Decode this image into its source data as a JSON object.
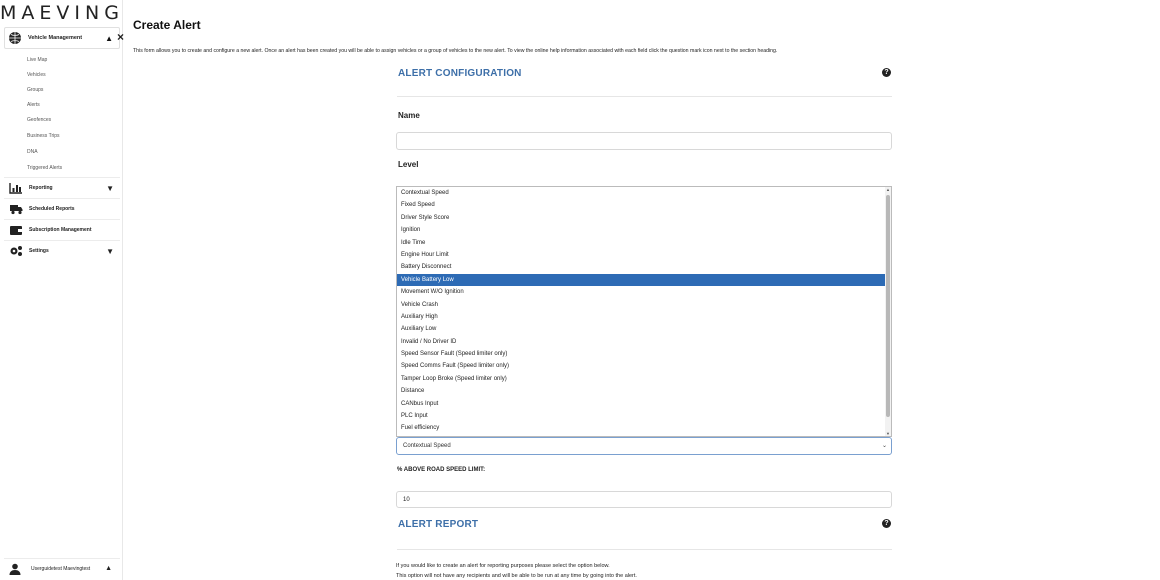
{
  "brand": "MAEVING",
  "sidebar": {
    "vehicle_management": "Vehicle Management",
    "sub_items": [
      "Live Map",
      "Vehicles",
      "Groups",
      "Alerts",
      "Geofences",
      "Business Trips",
      "DNA",
      "Triggered Alerts"
    ],
    "reporting": "Reporting",
    "scheduled_reports": "Scheduled Reports",
    "subscription_management": "Subscription Management",
    "settings": "Settings",
    "user": "Userguidetest Maevingtest"
  },
  "close_glyph": "×",
  "page": {
    "title": "Create Alert",
    "description": "This form allows you to create and configure a new alert. Once an alert has been created you will be able to assign vehicles or a group of vehicles to the new alert. To view the online help information associated with each field click the question mark icon next to the section heading."
  },
  "config": {
    "heading": "ALERT CONFIGURATION",
    "name_label": "Name",
    "name_value": "",
    "level_label": "Level",
    "options": [
      "Contextual Speed",
      "Fixed Speed",
      "Driver Style Score",
      "Ignition",
      "Idle Time",
      "Engine Hour Limit",
      "Battery Disconnect",
      "Vehicle Battery Low",
      "Movement W/O Ignition",
      "Vehicle Crash",
      "Auxiliary High",
      "Auxiliary Low",
      "Invalid / No Driver ID",
      "Speed Sensor Fault (Speed limiter only)",
      "Speed Comms Fault (Speed limiter only)",
      "Tamper Loop Broke (Speed limiter only)",
      "Distance",
      "CANbus Input",
      "PLC Input",
      "Fuel efficiency"
    ],
    "highlighted_option": "Vehicle Battery Low",
    "selected_value": "Contextual Speed",
    "speed_label": "% ABOVE ROAD SPEED LIMIT:",
    "speed_value": "10"
  },
  "report": {
    "heading": "ALERT REPORT",
    "line1": "If you would like to create an alert for reporting purposes please select the option below.",
    "line2": "This option will not have any recipients and will be able to be run at any time by going into the alert."
  },
  "help_glyph": "?",
  "colors": {
    "accent": "#3d6fa8",
    "highlight": "#2d6bb5"
  }
}
